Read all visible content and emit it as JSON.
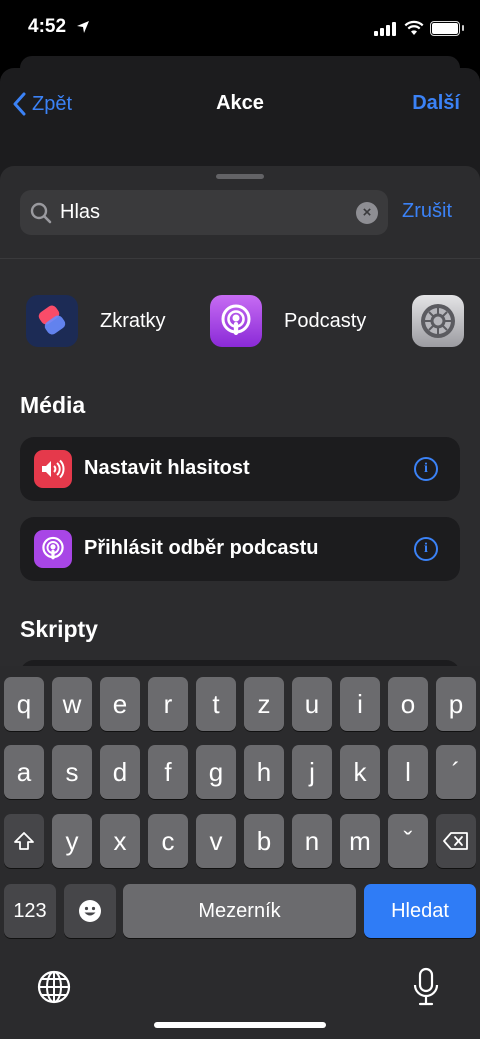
{
  "status": {
    "time": "4:52"
  },
  "nav": {
    "back": "Zpět",
    "title": "Akce",
    "next": "Další"
  },
  "search": {
    "value": "Hlas",
    "cancel": "Zrušit"
  },
  "apps": [
    {
      "label": "Zkratky",
      "icon": "shortcuts-icon"
    },
    {
      "label": "Podcasty",
      "icon": "podcasts-icon"
    },
    {
      "label": "",
      "icon": "settings-icon"
    }
  ],
  "sections": [
    {
      "title": "Média",
      "items": [
        {
          "label": "Nastavit hlasitost",
          "icon": "volume-icon",
          "color": "#e5394b"
        },
        {
          "label": "Přihlásit odběr podcastu",
          "icon": "podcast-icon",
          "color": "#a846e6"
        }
      ]
    },
    {
      "title": "Skripty",
      "items": []
    }
  ],
  "keyboard": {
    "row1": [
      "q",
      "w",
      "e",
      "r",
      "t",
      "z",
      "u",
      "i",
      "o",
      "p"
    ],
    "row2": [
      "a",
      "s",
      "d",
      "f",
      "g",
      "h",
      "j",
      "k",
      "l",
      "´"
    ],
    "row3": [
      "y",
      "x",
      "c",
      "v",
      "b",
      "n",
      "m",
      "ˇ"
    ],
    "numbers": "123",
    "space": "Mezerník",
    "search": "Hledat"
  },
  "info_glyph": "i",
  "clear_glyph": "×"
}
